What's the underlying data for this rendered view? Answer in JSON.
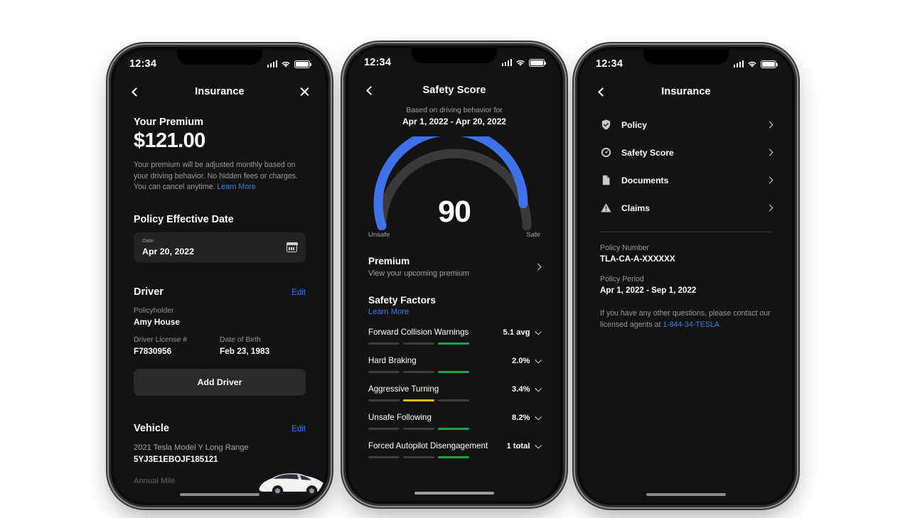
{
  "statusbar": {
    "time": "12:34",
    "icons": [
      "cellular-bars-icon",
      "wifi-icon",
      "battery-icon"
    ]
  },
  "phone1": {
    "nav": {
      "back": "back-chevron-icon",
      "title": "Insurance",
      "close": "close-icon"
    },
    "premium": {
      "heading": "Your Premium",
      "amount": "$121.00",
      "description": "Your premium will be adjusted monthly based on your driving behavior. No hidden fees or charges. You can cancel anytime. ",
      "learn_more": "Learn More"
    },
    "policy_effective_date": {
      "heading": "Policy Effective Date",
      "field_label": "Date",
      "field_value": "Apr 20, 2022",
      "icon": "calendar-icon"
    },
    "driver": {
      "heading": "Driver",
      "edit": "Edit",
      "policyholder_label": "Policyholder",
      "policyholder_value": "Amy House",
      "license_label": "Driver License #",
      "license_value": "F7830956",
      "dob_label": "Date of Birth",
      "dob_value": "Feb 23, 1983",
      "add_driver": "Add Driver"
    },
    "vehicle": {
      "heading": "Vehicle",
      "edit": "Edit",
      "model": "2021 Tesla Model Y Long Range",
      "vin": "5YJ3E1EBOJF185121",
      "cut_off": "Annual Mile"
    }
  },
  "phone2": {
    "nav": {
      "back": "back-chevron-icon",
      "title": "Safety Score"
    },
    "header": {
      "subtitle": "Based on driving behavior for",
      "date_range": "Apr 1, 2022 - Apr 20, 2022"
    },
    "gauge": {
      "value": "90",
      "left_label": "Unsafe",
      "right_label": "Safe",
      "fill_color": "#3f72e8",
      "track_color": "#3a3a3c"
    },
    "premium_row": {
      "title": "Premium",
      "subtitle": "View your upcoming premium",
      "chevron": "chevron-right-icon"
    },
    "safety_factors": {
      "heading": "Safety Factors",
      "learn_more": "Learn More",
      "items": [
        {
          "name": "Forward Collision Warnings",
          "value": "5.1 avg",
          "segments": [
            "off",
            "off",
            "green"
          ]
        },
        {
          "name": "Hard Braking",
          "value": "2.0%",
          "segments": [
            "off",
            "off",
            "green"
          ]
        },
        {
          "name": "Aggressive Turning",
          "value": "3.4%",
          "segments": [
            "off",
            "yellow",
            "off"
          ]
        },
        {
          "name": "Unsafe Following",
          "value": "8.2%",
          "segments": [
            "off",
            "off",
            "green"
          ]
        },
        {
          "name": "Forced Autopilot Disengagement",
          "value": "1 total",
          "segments": [
            "off",
            "off",
            "green"
          ]
        }
      ]
    }
  },
  "phone3": {
    "nav": {
      "back": "back-chevron-icon",
      "title": "Insurance"
    },
    "menu": [
      {
        "label": "Policy",
        "icon": "shield-check-icon"
      },
      {
        "label": "Safety Score",
        "icon": "speedometer-icon"
      },
      {
        "label": "Documents",
        "icon": "document-icon"
      },
      {
        "label": "Claims",
        "icon": "warning-triangle-icon"
      }
    ],
    "details": {
      "policy_number_label": "Policy Number",
      "policy_number_value": "TLA-CA-A-XXXXXX",
      "policy_period_label": "Policy Period",
      "policy_period_value": "Apr 1, 2022 - Sep 1, 2022",
      "note_prefix": "If you have any other questions, please contact our licensed agents at ",
      "note_phone": "1-844-34-TESLA"
    }
  },
  "colors": {
    "accent_blue": "#3f7ce8",
    "green": "#19a34a",
    "yellow": "#e3b61b",
    "screen_bg": "#131314"
  }
}
